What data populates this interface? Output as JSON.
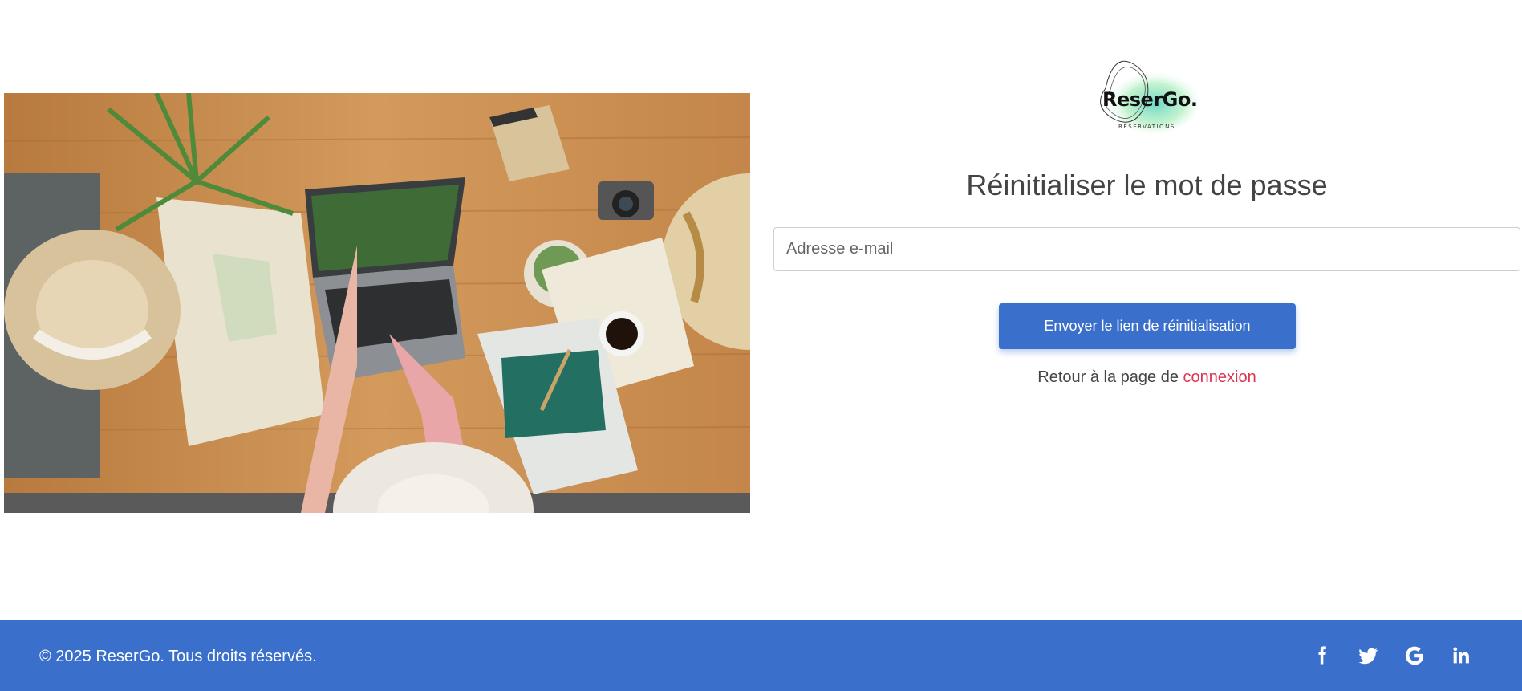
{
  "brand": {
    "logo_text": "ReserGo.",
    "logo_subtext": "RÉSERVATIONS"
  },
  "hero": {
    "image_icon": "travel-planning-photo"
  },
  "form": {
    "title": "Réinitialiser le mot de passe",
    "email_placeholder": "Adresse e-mail",
    "email_value": "",
    "submit_label": "Envoyer le lien de réinitialisation",
    "back_text": "Retour à la page de ",
    "back_link_label": "connexion"
  },
  "footer": {
    "copyright": "© 2025 ReserGo. Tous droits réservés.",
    "social_icons": [
      "facebook-icon",
      "twitter-icon",
      "google-icon",
      "linkedin-icon"
    ]
  },
  "colors": {
    "primary": "#3a6fcb",
    "link": "#dc3552",
    "text": "#444444"
  }
}
